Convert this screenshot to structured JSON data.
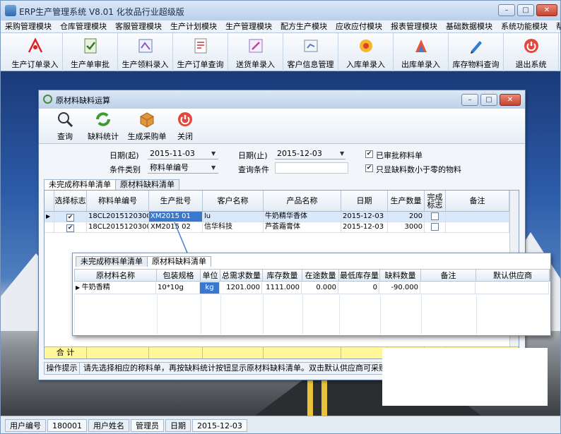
{
  "app": {
    "title": "ERP生产管理系统   V8.01  化妆品行业超级版",
    "window_buttons": {
      "minimize": "–",
      "maximize": "□",
      "close": "✕"
    }
  },
  "menu": [
    "采购管理模块",
    "仓库管理模块",
    "客服管理模块",
    "生产计划模块",
    "生产管理模块",
    "配方生产模块",
    "应收应付模块",
    "报表管理模块",
    "基础数据模块",
    "系统功能模块",
    "帮助"
  ],
  "toolbar": [
    {
      "label": "生产订单录入",
      "icon": "pdf-icon"
    },
    {
      "label": "生产单审批",
      "icon": "approve-icon"
    },
    {
      "label": "生产领料录入",
      "icon": "pick-material-icon"
    },
    {
      "label": "生产订单查询",
      "icon": "order-query-icon"
    },
    {
      "label": "送货单录入",
      "icon": "delivery-icon"
    },
    {
      "label": "客户信息管理",
      "icon": "customer-icon"
    },
    {
      "label": "入库单录入",
      "icon": "stock-in-icon"
    },
    {
      "label": "出库单录入",
      "icon": "stock-out-icon"
    },
    {
      "label": "库存物料查询",
      "icon": "inventory-query-icon"
    },
    {
      "label": "退出系统",
      "icon": "exit-icon"
    }
  ],
  "dialog": {
    "title": "原材料缺料运算",
    "tools": [
      {
        "label": "查询",
        "icon": "magnifier-icon"
      },
      {
        "label": "缺料统计",
        "icon": "refresh-icon"
      },
      {
        "label": "生成采购单",
        "icon": "box-icon"
      },
      {
        "label": "关闭",
        "icon": "power-icon"
      }
    ],
    "filters": {
      "date_from_label": "日期(起)",
      "date_from_value": "2015-11-03",
      "date_to_label": "日期(止)",
      "date_to_value": "2015-12-03",
      "category_label": "条件类别",
      "category_value": "称料单编号",
      "query_label": "查询条件",
      "query_value": "",
      "approved_only_label": "已审批称料单",
      "approved_only_checked": true,
      "shortage_only_label": "只显缺料数小于零的物料",
      "shortage_only_checked": true
    },
    "tabs": [
      "未完成称料单清单",
      "原材料缺料清单"
    ],
    "grid": {
      "columns": [
        "选择标志",
        "称料单编号",
        "生产批号",
        "客户名称",
        "产品名称",
        "日期",
        "生产数量",
        "完成标志",
        "备注"
      ],
      "rows": [
        {
          "selected": true,
          "code": "18CL20151203001",
          "batch": "XM2015 01",
          "customer": "lu",
          "product": "牛奶精华香体",
          "date": "2015-12-03",
          "qty": "200",
          "done": false,
          "note": ""
        },
        {
          "selected": true,
          "code": "18CL20151203002",
          "batch": "XM2015 02",
          "customer": "信华科技",
          "product": "芦荟霜膏体",
          "date": "2015-12-03",
          "qty": "3000",
          "done": false,
          "note": ""
        }
      ],
      "sum_label": "合 计"
    },
    "hint_label": "操作提示",
    "hint_text": "请先选择相应的称料单，再按缺料统计按钮显示原材料缺料清单。双击默认供应商可采购针对供"
  },
  "subgrid": {
    "tabs": [
      "未完成称料单清单",
      "原材料缺料清单"
    ],
    "columns": [
      "原材料名称",
      "包装规格",
      "单位",
      "总需求数量",
      "库存数量",
      "在途数量",
      "最低库存量",
      "缺料数量",
      "备注",
      "默认供应商"
    ],
    "rows": [
      {
        "name": "牛奶香精",
        "spec": "10*10g",
        "unit": "kg",
        "demand": "1201.000",
        "stock": "1111.000",
        "transit": "0.000",
        "min_stock": "0",
        "shortage": "-90.000",
        "note": "",
        "supplier": ""
      }
    ]
  },
  "status": {
    "user_code_label": "用户编号",
    "user_code": "180001",
    "user_name_label": "用户姓名",
    "user_name": "管理员",
    "date_label": "日期",
    "date": "2015-12-03"
  },
  "colors": {
    "sum_row": "#fff79a",
    "selected_cell": "#3a78d0",
    "accent": "#2f69b0"
  }
}
